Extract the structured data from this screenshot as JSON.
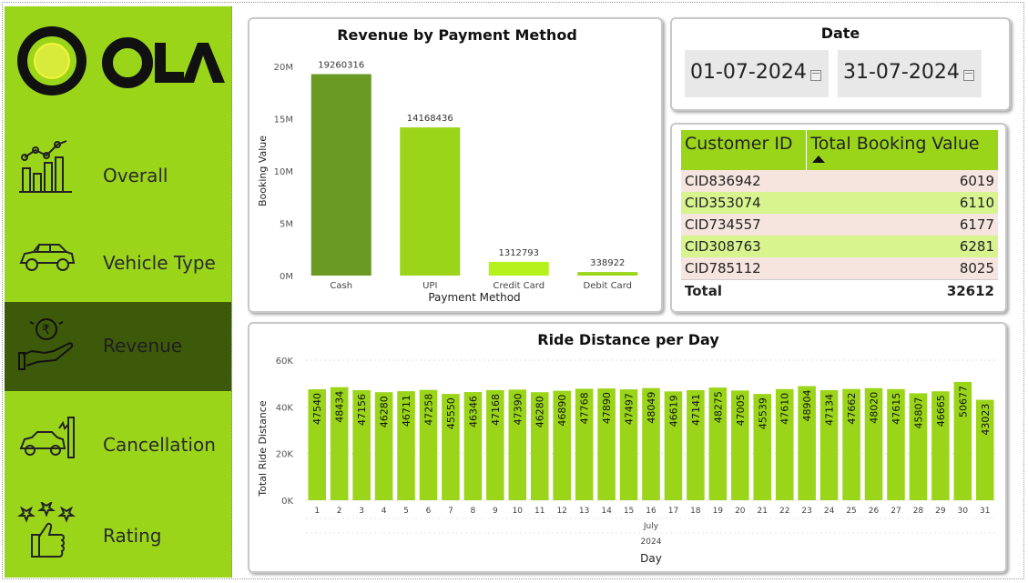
{
  "brand": {
    "name": "OLA",
    "logo_icon": "ola-logo-icon"
  },
  "sidebar": {
    "items": [
      {
        "label": "Overall",
        "icon": "bar-chart-trend-icon"
      },
      {
        "label": "Vehicle Type",
        "icon": "car-icon"
      },
      {
        "label": "Revenue",
        "icon": "rupee-hand-icon",
        "active": true
      },
      {
        "label": "Cancellation",
        "icon": "car-crash-icon"
      },
      {
        "label": "Rating",
        "icon": "stars-thumbs-up-icon"
      }
    ],
    "bg_color": "#9bd51a",
    "active_color": "#3d5a0a"
  },
  "date_filter": {
    "title": "Date",
    "start": "01-07-2024",
    "end": "31-07-2024"
  },
  "customer_table": {
    "headers": [
      "Customer ID",
      "Total Booking Value"
    ],
    "rows": [
      [
        "CID836942",
        "6019"
      ],
      [
        "CID353074",
        "6110"
      ],
      [
        "CID734557",
        "6177"
      ],
      [
        "CID308763",
        "6281"
      ],
      [
        "CID785112",
        "8025"
      ]
    ],
    "total_label": "Total",
    "total_value": "32612",
    "sort_icon": "sort-ascending-icon"
  },
  "chart_data": [
    {
      "type": "bar",
      "title": "Revenue by Payment Method",
      "xlabel": "Payment Method",
      "ylabel": "Booking Value",
      "categories": [
        "Cash",
        "UPI",
        "Credit Card",
        "Debit Card"
      ],
      "values": [
        19260316,
        14168436,
        1312793,
        338922
      ],
      "colors": [
        "#6a9a23",
        "#9bd51a",
        "#b5f21d",
        "#9bd51a"
      ],
      "ylim": [
        0,
        20000000
      ],
      "yticks": [
        0,
        5000000,
        10000000,
        15000000,
        20000000
      ],
      "ytick_labels": [
        "0M",
        "5M",
        "10M",
        "15M",
        "20M"
      ]
    },
    {
      "type": "bar",
      "title": "Ride Distance per Day",
      "xlabel": "Day",
      "ylabel": "Total Ride Distance",
      "x_month": "July",
      "x_year": "2024",
      "categories": [
        "1",
        "2",
        "3",
        "4",
        "5",
        "6",
        "7",
        "8",
        "9",
        "10",
        "11",
        "12",
        "13",
        "14",
        "15",
        "16",
        "17",
        "18",
        "19",
        "20",
        "21",
        "22",
        "23",
        "24",
        "25",
        "26",
        "27",
        "28",
        "29",
        "30",
        "31"
      ],
      "values": [
        47540,
        48434,
        47156,
        46280,
        46711,
        47258,
        45550,
        46346,
        47168,
        47390,
        46280,
        46890,
        47768,
        47890,
        47497,
        48049,
        46619,
        47141,
        48275,
        47005,
        45539,
        47610,
        48904,
        47134,
        47662,
        48020,
        47615,
        45807,
        46665,
        50677,
        43023
      ],
      "color": "#9bd51a",
      "ylim": [
        0,
        60000
      ],
      "yticks": [
        0,
        20000,
        40000,
        60000
      ],
      "ytick_labels": [
        "0K",
        "20K",
        "40K",
        "60K"
      ]
    }
  ]
}
